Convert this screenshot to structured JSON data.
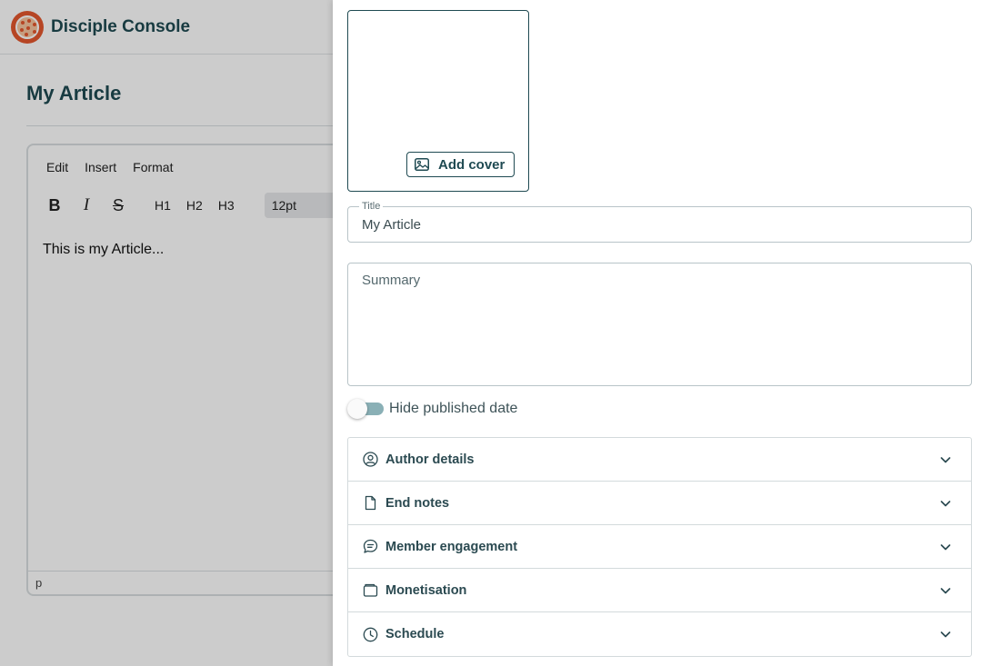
{
  "app": {
    "brand": "Disciple Console",
    "page_title": "My Article"
  },
  "editor": {
    "menu": [
      "Edit",
      "Insert",
      "Format"
    ],
    "toolbar": {
      "bold": "B",
      "italic": "I",
      "strike": "S",
      "h1": "H1",
      "h2": "H2",
      "h3": "H3",
      "font_size": "12pt"
    },
    "content": "This is my Article...",
    "status_path": "p"
  },
  "panel": {
    "add_cover_label": "Add cover",
    "title_field": {
      "label": "Title",
      "value": "My Article"
    },
    "summary_field": {
      "placeholder": "Summary"
    },
    "hide_published_date": {
      "label": "Hide published date",
      "enabled": false
    },
    "sections": [
      {
        "label": "Author details",
        "icon": "user-circle-icon"
      },
      {
        "label": "End notes",
        "icon": "document-icon"
      },
      {
        "label": "Member engagement",
        "icon": "chat-bubble-icon"
      },
      {
        "label": "Monetisation",
        "icon": "wallet-icon"
      },
      {
        "label": "Schedule",
        "icon": "clock-icon"
      }
    ]
  },
  "colors": {
    "brand_dark": "#1f4a52",
    "logo_orange": "#e4572e",
    "toggle_track": "#8ab0b6"
  }
}
